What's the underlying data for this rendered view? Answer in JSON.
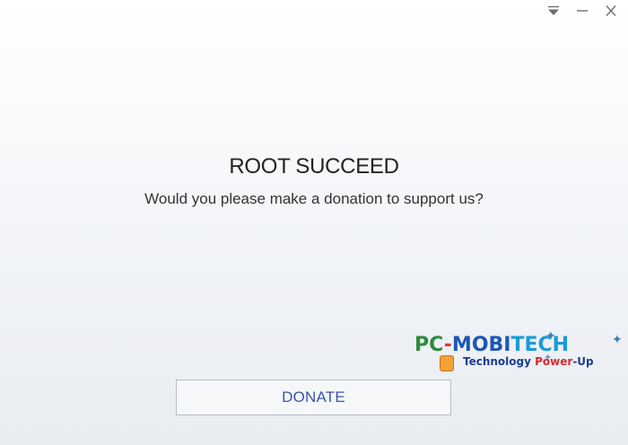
{
  "window": {
    "controls": {
      "menu": "dropdown-icon",
      "minimize": "minimize-icon",
      "close": "close-icon"
    }
  },
  "main": {
    "title": "ROOT SUCCEED",
    "message": "Would you please make a donation to support us?"
  },
  "actions": {
    "donate_label": "DONATE"
  },
  "watermark": {
    "line1_part1": "PC",
    "line1_part2": "-",
    "line1_part3": "MOBI",
    "line1_part4": "TECH",
    "line2_part1": "Technology ",
    "line2_part2": "Power",
    "line2_part3": "-Up"
  },
  "colors": {
    "accent_text": "#3a55a8",
    "button_border": "#b9bec6",
    "title_text": "#222222"
  }
}
